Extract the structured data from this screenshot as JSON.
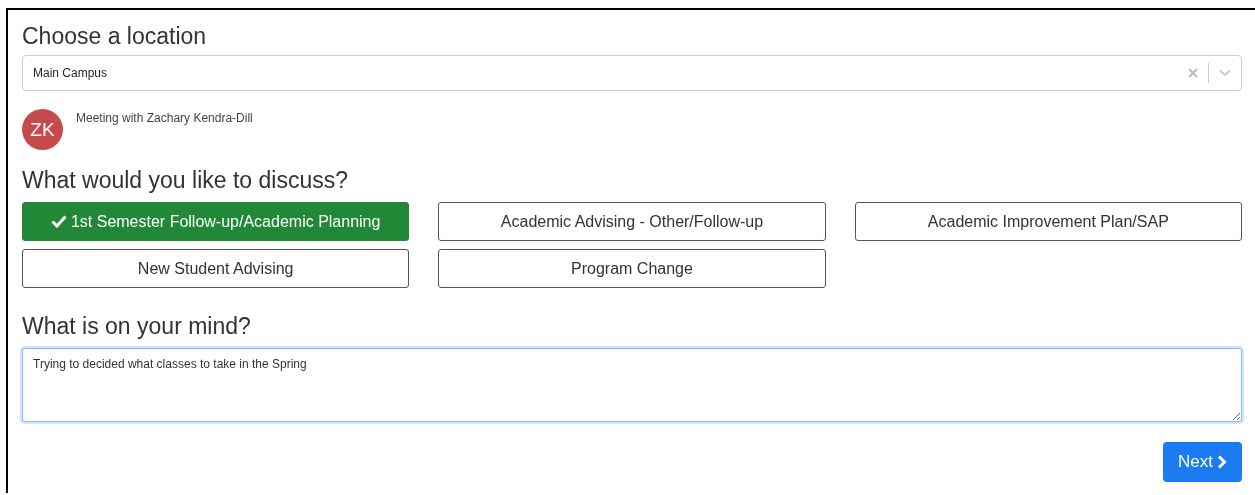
{
  "location": {
    "heading": "Choose a location",
    "value": "Main Campus"
  },
  "advisor": {
    "initials": "ZK",
    "meeting": "Meeting with Zachary Kendra-Dill"
  },
  "topics": {
    "heading": "What would you like to discuss?",
    "options": [
      {
        "label": "1st Semester Follow-up/Academic Planning",
        "selected": true
      },
      {
        "label": "Academic Advising - Other/Follow-up",
        "selected": false
      },
      {
        "label": "Academic Improvement Plan/SAP",
        "selected": false
      },
      {
        "label": "New Student Advising",
        "selected": false
      },
      {
        "label": "Program Change",
        "selected": false
      }
    ]
  },
  "mind": {
    "heading": "What is on your mind?",
    "value": "Trying to decided what classes to take in the Spring"
  },
  "next_button": "Next"
}
